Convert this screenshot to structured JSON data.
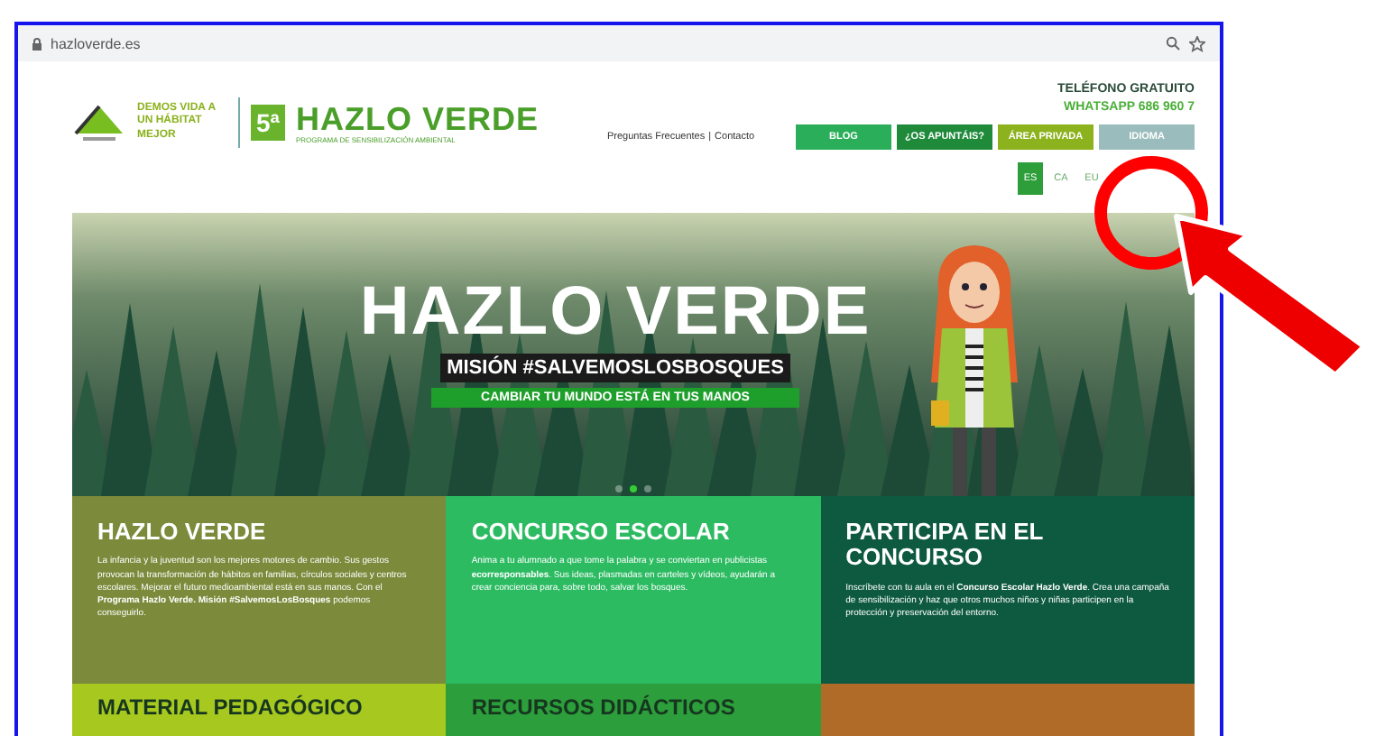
{
  "browser": {
    "url": "hazloverde.es"
  },
  "header": {
    "tagline": "DEMOS VIDA A UN HÁBITAT MEJOR",
    "edition": "5ª",
    "logo_title": "HAZLO VERDE",
    "logo_subtitle": "PROGRAMA DE SENSIBILIZACIÓN AMBIENTAL",
    "links": [
      "Preguntas Frecuentes",
      "Contacto"
    ],
    "separator": "|",
    "phone": "TELÉFONO GRATUITO",
    "whatsapp": "WHATSAPP 686 960 7"
  },
  "nav": [
    {
      "label": "BLOG",
      "color": "#2bae5a"
    },
    {
      "label": "¿OS APUNTÁIS?",
      "color": "#1e8a3a"
    },
    {
      "label": "ÁREA PRIVADA",
      "color": "#8cb21e"
    },
    {
      "label": "IDIOMA",
      "color": "#9bbcbc"
    }
  ],
  "languages": [
    {
      "label": "ES",
      "selected": true
    },
    {
      "label": "CA",
      "selected": false
    },
    {
      "label": "EU",
      "selected": false
    }
  ],
  "hero": {
    "title": "HAZLO VERDE",
    "mission": "MISIÓN #SALVEMOSLOSBOSQUES",
    "slogan": "CAMBIAR TU MUNDO ESTÁ EN TUS MANOS",
    "slides": [
      {
        "selected": false
      },
      {
        "selected": true
      },
      {
        "selected": false
      }
    ]
  },
  "cards": [
    {
      "title": "HAZLO VERDE",
      "color": "#7b8a3b",
      "body": "La infancia y la juventud son los mejores motores de cambio. Sus gestos provocan la transformación de hábitos en familias, círculos sociales y centros escolares. Mejorar el futuro medioambiental está en sus manos. Con el **Programa Hazlo Verde. Misión #SalvemosLosBosques** podemos conseguirlo."
    },
    {
      "title": "CONCURSO ESCOLAR",
      "color": "#2dbb62",
      "body": "Anima a tu alumnado a que tome la palabra y se conviertan en publicistas **ecorresponsables**. Sus ideas, plasmadas en carteles y vídeos, ayudarán a crear conciencia para, sobre todo, salvar los bosques."
    },
    {
      "title": "PARTICIPA EN EL CONCURSO",
      "color": "#0e5a40",
      "body": "Inscríbete con tu aula en el **Concurso Escolar Hazlo Verde**. Crea una campaña de sensibilización y haz que otros muchos niños y niñas participen en la protección y preservación del entorno."
    }
  ],
  "more_cards": [
    {
      "title": "MATERIAL PEDAGÓGICO",
      "color": "#a6c81f"
    },
    {
      "title": "RECURSOS DIDÁCTICOS",
      "color": "#2c9e3b"
    },
    {
      "color": "#b06b28"
    }
  ]
}
